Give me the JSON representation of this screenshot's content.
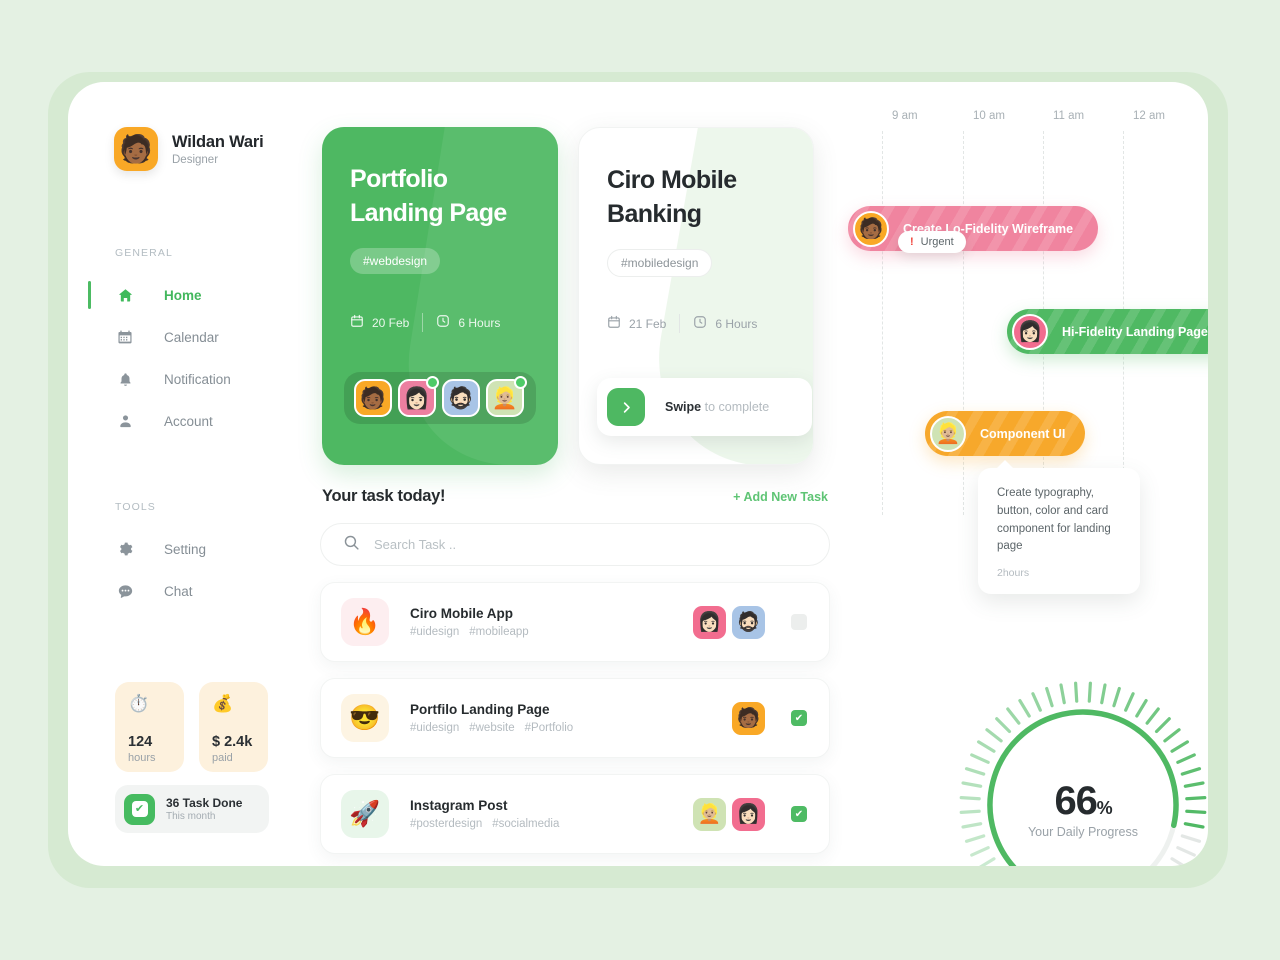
{
  "profile": {
    "name": "Wildan Wari",
    "role": "Designer",
    "avatar_emoji": "🧑🏾"
  },
  "sidebar": {
    "general_label": "GENERAL",
    "tools_label": "TOOLS",
    "general_items": [
      {
        "label": "Home",
        "icon": "home-icon",
        "active": true
      },
      {
        "label": "Calendar",
        "icon": "calendar-icon",
        "active": false
      },
      {
        "label": "Notification",
        "icon": "bell-icon",
        "active": false
      },
      {
        "label": "Account",
        "icon": "person-icon",
        "active": false
      }
    ],
    "tools_items": [
      {
        "label": "Setting",
        "icon": "gear-icon",
        "active": false
      },
      {
        "label": "Chat",
        "icon": "chat-icon",
        "active": false
      }
    ],
    "stats": [
      {
        "emoji": "⏱️",
        "value": "124",
        "label": "hours"
      },
      {
        "emoji": "💰",
        "value": "$ 2.4k",
        "label": "paid"
      }
    ],
    "task_done": {
      "title": "36 Task Done",
      "subtitle": "This month",
      "check": "✔"
    }
  },
  "cards": [
    {
      "title": "Portfolio\nLanding Page",
      "tag": "#webdesign",
      "date": "20 Feb",
      "duration": "6 Hours",
      "members": [
        {
          "emoji": "🧑🏾",
          "color": "av-orange",
          "online": false
        },
        {
          "emoji": "👩🏻",
          "color": "av-pink",
          "online": true
        },
        {
          "emoji": "🧔🏻",
          "color": "av-blue",
          "online": false
        },
        {
          "emoji": "👱🏼",
          "color": "av-mint",
          "online": true
        }
      ]
    },
    {
      "title": "Ciro Mobile\nBanking",
      "tag": "#mobiledesign",
      "date": "21 Feb",
      "duration": "6 Hours",
      "swipe_bold": "Swipe",
      "swipe_rest": " to complete",
      "swipe_icon": "chevron-right-icon"
    }
  ],
  "tasks": {
    "title": "Your task today!",
    "add_label": "+ Add New Task",
    "search_placeholder": "Search Task ..",
    "search_value": "",
    "rows": [
      {
        "name": "Ciro Mobile App",
        "tags": [
          "#uidesign",
          "#mobileapp"
        ],
        "emoji": "🔥",
        "emoji_bg": "te-pink",
        "avatars": [
          {
            "emoji": "👩🏻",
            "color": "av-rose"
          },
          {
            "emoji": "🧔🏻",
            "color": "av-blue"
          }
        ],
        "checked": false
      },
      {
        "name": "Portfilo Landing Page",
        "tags": [
          "#uidesign",
          "#website",
          "#Portfolio"
        ],
        "emoji": "😎",
        "emoji_bg": "te-cream",
        "avatars": [
          {
            "emoji": "🧑🏾",
            "color": "av-orange"
          }
        ],
        "checked": true
      },
      {
        "name": "Instagram Post",
        "tags": [
          "#posterdesign",
          "#socialmedia"
        ],
        "emoji": "🚀",
        "emoji_bg": "te-mint",
        "avatars": [
          {
            "emoji": "👱🏼",
            "color": "av-mint"
          },
          {
            "emoji": "👩🏻",
            "color": "av-rose"
          }
        ],
        "checked": true
      }
    ],
    "check_glyph": "✔"
  },
  "timeline": {
    "hours": [
      "9 am",
      "10 am",
      "11 am",
      "12 am"
    ],
    "bars": [
      {
        "label": "Create Lo-Fidelity Wireframe",
        "color_class": "bar-pink",
        "avatar_emoji": "🧑🏾",
        "avatar_color": "av-orange",
        "badge": {
          "icon": "!",
          "label": "Urgent"
        }
      },
      {
        "label": "Hi-Fidelity Landing Page UI",
        "color_class": "bar-green",
        "avatar_emoji": "👩🏻",
        "avatar_color": "av-rose"
      },
      {
        "label": "Component UI",
        "color_class": "bar-orange",
        "avatar_emoji": "👱🏼",
        "avatar_color": "av-mint",
        "tooltip": {
          "text": "Create typography, button, color and card component for landing page",
          "time": "2hours"
        }
      }
    ]
  },
  "chart_data": {
    "type": "pie",
    "title": "Your Daily Progress",
    "value": 66,
    "unit": "%",
    "max": 100,
    "label": "Your Daily Progress",
    "colors": {
      "active": "#4fb963",
      "inactive": "#dfe3e1"
    }
  },
  "colors": {
    "page_bg": "#e4f1e3",
    "backdrop": "#d6ead2",
    "panel": "#ffffff",
    "accent_green": "#4eb862",
    "pink": "#f0849f",
    "orange": "#f7a82b"
  }
}
